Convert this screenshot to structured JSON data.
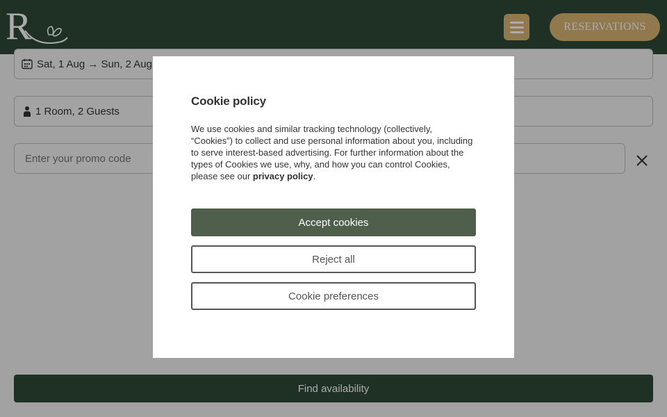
{
  "header": {
    "brand_letter": "R",
    "reservations_label": "RESERVATIONS",
    "colors": {
      "background": "#2f4a36",
      "accent": "#d8b373"
    }
  },
  "booking": {
    "dates_label": "Sat, 1 Aug → Sun, 2 Aug",
    "guests_label": "1 Room, 2 Guests",
    "promo_placeholder": "Enter your promo code",
    "find_label": "Find availability"
  },
  "cookie_modal": {
    "title": "Cookie policy",
    "body": "We use cookies and similar tracking technology (collectively, “Cookies”) to collect and use personal information about you, including to serve interest-based advertising. For further information about the types of Cookies we use, why, and how you can control Cookies, please see our ",
    "link_label": "privacy policy",
    "body_end": ".",
    "accept_label": "Accept cookies",
    "reject_label": "Reject all",
    "preferences_label": "Cookie preferences",
    "colors": {
      "accept_button": "#4f5f4b"
    }
  }
}
